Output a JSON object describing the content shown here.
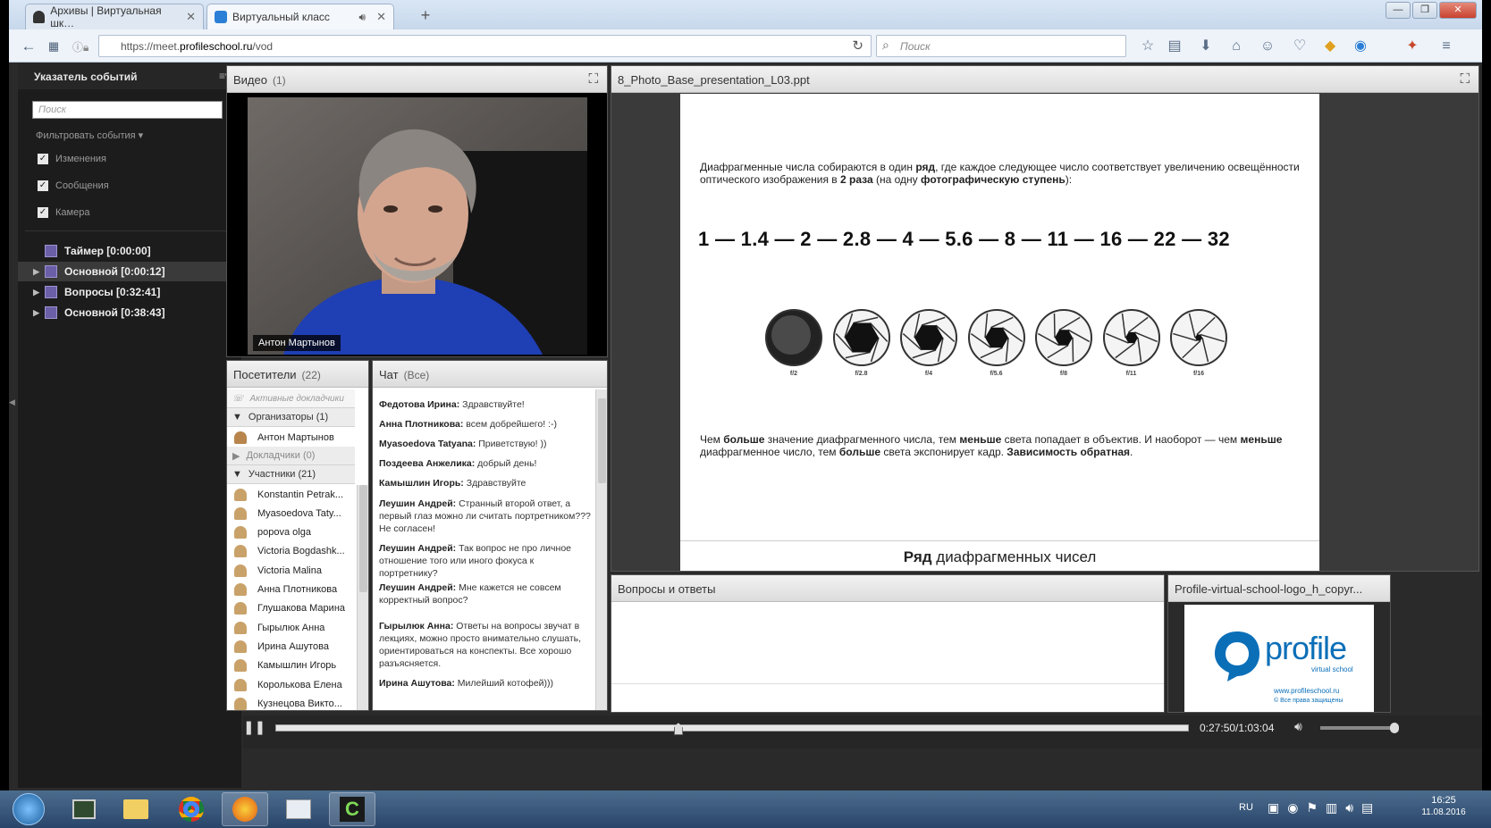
{
  "browser": {
    "tabs": [
      {
        "title": "Архивы | Виртуальная шк…",
        "active": false
      },
      {
        "title": "Виртуальный класс",
        "active": true
      }
    ],
    "url_prefix": "https://meet.",
    "url_domain": "profileschool.ru",
    "url_path": "/vod",
    "search_placeholder": "Поиск"
  },
  "sidebar": {
    "title": "Указатель событий",
    "search_placeholder": "Поиск",
    "filter_label": "Фильтровать события",
    "filters": [
      {
        "label": "Изменения",
        "checked": true
      },
      {
        "label": "Сообщения",
        "checked": true
      },
      {
        "label": "Камера",
        "checked": true
      }
    ],
    "events": [
      {
        "label": "Таймер [0:00:00]",
        "expandable": false,
        "selected": false
      },
      {
        "label": "Основной [0:00:12]",
        "expandable": true,
        "selected": true
      },
      {
        "label": "Вопросы [0:32:41]",
        "expandable": true,
        "selected": false
      },
      {
        "label": "Основной [0:38:43]",
        "expandable": true,
        "selected": false
      }
    ]
  },
  "video_pod": {
    "title": "Видео",
    "count": "(1)",
    "presenter_name": "Антон Мартынов"
  },
  "attendees_pod": {
    "title": "Посетители",
    "count": "(22)",
    "active_speakers": "Активные докладчики",
    "organizers_group": "Организаторы (1)",
    "organizers": [
      "Антон Мартынов"
    ],
    "speakers_group": "Докладчики (0)",
    "participants_group": "Участники (21)",
    "participants": [
      "Konstantin Petrak...",
      "Myasoedova Taty...",
      "popova olga",
      "Victoria Bogdashk...",
      "Victoria Malina",
      "Анна Плотникова",
      "Глушакова Марина",
      "Гырылюк Анна",
      "Ирина Ашутова",
      "Камышлин Игорь",
      "Королькова Елена",
      "Кузнецова Викто..."
    ]
  },
  "chat_pod": {
    "title": "Чат",
    "scope": "(Все)",
    "messages": [
      {
        "author": "Федотова Ирина:",
        "text": " Здравствуйте!"
      },
      {
        "author": "Анна Плотникова:",
        "text": " всем добрейшего! :-)"
      },
      {
        "author": "Myasoedova Tatyana:",
        "text": " Приветствую! ))"
      },
      {
        "author": "Поздеева Анжелика:",
        "text": " добрый день!"
      },
      {
        "author": "Камышлин Игорь:",
        "text": " Здравствуйте"
      },
      {
        "author": "Леушин Андрей:",
        "text": " Странный второй ответ, а первый глаз можно ли считать портретником??? Не согласен!"
      },
      {
        "author": "Леушин Андрей:",
        "text": " Так вопрос не про личное отношение того или иного фокуса к портретнику?"
      },
      {
        "author": "Леушин Андрей:",
        "text": " Мне кажется не совсем корректный вопрос?"
      },
      {
        "author": "Гырылюк Анна:",
        "text": " Ответы на вопросы звучат в лекциях, можно просто внимательно слушать, ориентироваться на конспекты. Все хорошо разъясняется."
      },
      {
        "author": "Ирина Ашутова:",
        "text": " Милейший котофей)))"
      }
    ]
  },
  "slide_pod": {
    "title": "8_Photo_Base_presentation_L03.ppt",
    "para1": [
      {
        "t": "Диафрагменные числа собираются в один ",
        "b": false
      },
      {
        "t": "ряд",
        "b": true
      },
      {
        "t": ", где каждое следующее число соответствует увеличению освещённости оптического изображения в ",
        "b": false
      },
      {
        "t": "2 раза",
        "b": true
      },
      {
        "t": " (на одну ",
        "b": false
      },
      {
        "t": "фотографическую ступень",
        "b": true
      },
      {
        "t": "):",
        "b": false
      }
    ],
    "f_numbers": "1 — 1.4 — 2 — 2.8 — 4 — 5.6 — 8 — 11 — 16 — 22 — 32",
    "aperture_labels": [
      "f/2",
      "f/2.8",
      "f/4",
      "f/5.6",
      "f/8",
      "f/11",
      "f/16"
    ],
    "para2": [
      {
        "t": "Чем ",
        "b": false
      },
      {
        "t": "больше",
        "b": true
      },
      {
        "t": " значение диафрагменного числа, тем ",
        "b": false
      },
      {
        "t": "меньше",
        "b": true
      },
      {
        "t": " света попадает в объектив. И наоборот — чем ",
        "b": false
      },
      {
        "t": "меньше",
        "b": true
      },
      {
        "t": " диафрагменное число, тем ",
        "b": false
      },
      {
        "t": "больше",
        "b": true
      },
      {
        "t": " света экспонирует кадр. ",
        "b": false
      },
      {
        "t": "Зависимость обратная",
        "b": true
      },
      {
        "t": ".",
        "b": false
      }
    ],
    "caption_bold": "Ряд",
    "caption_rest": " диафрагменных чисел"
  },
  "qa_pod": {
    "title": "Вопросы и ответы"
  },
  "logo_pod": {
    "title": "Profile-virtual-school-logo_h_copyr...",
    "brand": "profile",
    "sub": "virtual school",
    "site": "www.profileschool.ru",
    "rights": "© Все права защищены"
  },
  "playback": {
    "time": "0:27:50/1:03:04",
    "progress": 0.441,
    "volume": 1.0
  },
  "taskbar": {
    "lang": "RU",
    "time": "16:25",
    "date": "11.08.2016"
  },
  "colors": {
    "accent_blue": "#0b6fb8",
    "event_icon": "#6b5fa8"
  }
}
